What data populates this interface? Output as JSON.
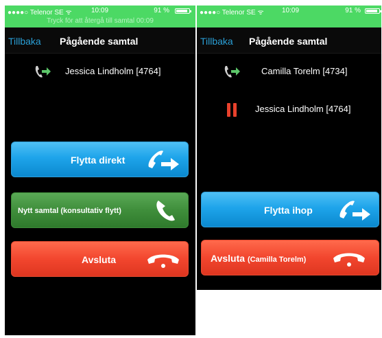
{
  "left": {
    "status": {
      "carrier": "●●●●○ Telenor SE ᯤ",
      "time": "10:09",
      "battery": "91 %",
      "banner": "Tryck för att återgå till samtal  00:09"
    },
    "nav": {
      "back": "Tillbaka",
      "title": "Pågående samtal"
    },
    "calls": [
      {
        "name": "Jessica Lindholm [4764]",
        "icon": "phone-transfer-icon"
      }
    ],
    "buttons": {
      "move_direct": "Flytta direkt",
      "new_call": "Nytt samtal (konsultativ flytt)",
      "end": "Avsluta"
    }
  },
  "right": {
    "status": {
      "carrier": "●●●●○ Telenor SE ᯤ",
      "time": "10:09",
      "battery": "91 %"
    },
    "nav": {
      "back": "Tillbaka",
      "title": "Pågående samtal"
    },
    "calls": [
      {
        "name": "Camilla Torelm [4734]",
        "icon": "phone-transfer-icon"
      },
      {
        "name": "Jessica Lindholm [4764]",
        "icon": "pause-icon"
      }
    ],
    "buttons": {
      "move_together": "Flytta ihop",
      "end_prefix": "Avsluta",
      "end_suffix": "(Camilla Torelm)"
    }
  },
  "colors": {
    "status_green": "#4cd964",
    "link_blue": "#2a9fd6",
    "button_blue": "#1ea4ea",
    "button_green": "#3f8e3b",
    "button_red": "#f2462e",
    "hold_red": "#e8412c"
  }
}
